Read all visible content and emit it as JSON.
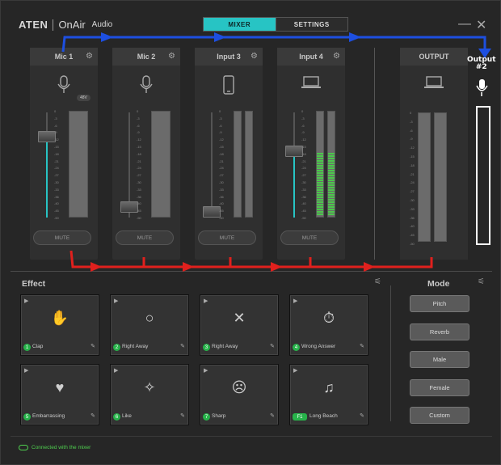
{
  "app": {
    "brand": "ATEN",
    "product": "OnAir",
    "product_suffix": "Audio"
  },
  "tabs": [
    {
      "label": "MIXER",
      "active": true
    },
    {
      "label": "SETTINGS",
      "active": false
    }
  ],
  "window": {
    "minimize_icon": "minimize-icon",
    "close_icon": "close-icon"
  },
  "scale_labels": [
    "0",
    "-3",
    "-6",
    "-9",
    "-12",
    "-15",
    "-18",
    "-21",
    "-24",
    "-27",
    "-30",
    "-33",
    "-36",
    "-40",
    "-45",
    "-50"
  ],
  "channels": [
    {
      "name": "Mic 1",
      "icon": "microphone-icon",
      "badge": "48V",
      "mute_label": "MUTE",
      "fader_level": 0.8,
      "meter": "single"
    },
    {
      "name": "Mic 2",
      "icon": "microphone-icon",
      "mute_label": "MUTE",
      "fader_level": 0.05,
      "meter": "single"
    },
    {
      "name": "Input 3",
      "icon": "phone-icon",
      "mute_label": "MUTE",
      "fader_level": 0.0,
      "meter": "stereo"
    },
    {
      "name": "Input 4",
      "icon": "laptop-icon",
      "mute_label": "MUTE",
      "fader_level": 0.65,
      "meter": "stereo-active"
    }
  ],
  "output": {
    "name": "OUTPUT",
    "icon": "laptop-icon"
  },
  "handwritten": {
    "line1": "Output",
    "line2": "#2"
  },
  "effects": {
    "title": "Effect",
    "items": [
      {
        "num": "1",
        "name": "Clap",
        "icon": "clap-icon"
      },
      {
        "num": "2",
        "name": "Right Away",
        "icon": "circle-icon"
      },
      {
        "num": "3",
        "name": "Right Away",
        "icon": "x-icon"
      },
      {
        "num": "4",
        "name": "Wrong Answer",
        "icon": "stopwatch-icon"
      },
      {
        "num": "5",
        "name": "Embarrassing",
        "icon": "heart-icon"
      },
      {
        "num": "6",
        "name": "Like",
        "icon": "sparkle-icon"
      },
      {
        "num": "7",
        "name": "Sharp",
        "icon": "sad-face-icon"
      },
      {
        "num": "F1",
        "name": "Long Beach",
        "icon": "music-file-icon"
      }
    ]
  },
  "mode": {
    "title": "Mode",
    "buttons": [
      "Pitch",
      "Reverb",
      "Male",
      "Female",
      "Custom"
    ]
  },
  "status": {
    "text": "Connected with the mixer"
  },
  "colors": {
    "accent": "#27c4c4",
    "ok": "#4fd04f",
    "annotation_blue": "#1d4fe0",
    "annotation_red": "#e0201d"
  }
}
